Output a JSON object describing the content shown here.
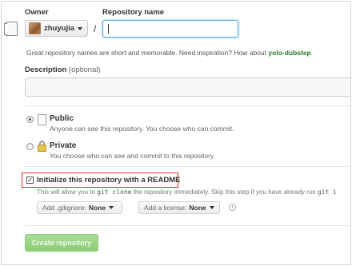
{
  "owner": {
    "label": "Owner",
    "value": "zhuyujia"
  },
  "repository": {
    "label": "Repository name",
    "value": ""
  },
  "hint": {
    "text": "Great repository names are short and memorable. Need inspiration? How about ",
    "suggestion": "yolo-dubstep",
    "end": "."
  },
  "description": {
    "label": "Description",
    "optional": "(optional)",
    "value": ""
  },
  "visibility": {
    "public": {
      "title": "Public",
      "desc": "Anyone can see this repository. You choose who can commit.",
      "selected": true
    },
    "private": {
      "title": "Private",
      "desc": "You choose who can see and commit to this repository.",
      "selected": false
    }
  },
  "readme": {
    "label": "Initialize this repository with a README",
    "checked": true,
    "help_pre": "This will allow you to ",
    "help_code": "git clone",
    "help_post": " the repository immediately. Skip this step if you have already run ",
    "help_code2": "git i"
  },
  "gitignore": {
    "label": "Add .gitignore:",
    "value": "None"
  },
  "license": {
    "label": "Add a license:",
    "value": "None"
  },
  "create_button": "Create repository",
  "colors": {
    "accent_green": "#8dcc78",
    "focus_blue": "#51a7e8",
    "highlight_red": "#e03030",
    "suggestion_green": "#2a7a2a"
  }
}
